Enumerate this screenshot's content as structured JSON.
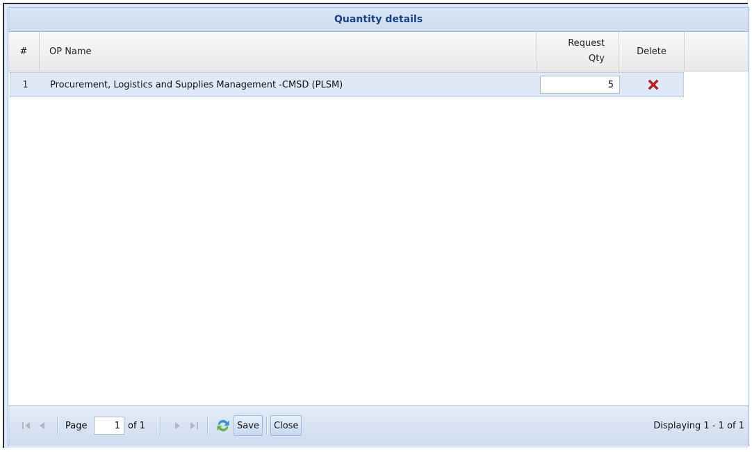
{
  "window": {
    "title": "Quantity details"
  },
  "grid": {
    "columns": {
      "num": "#",
      "op_name": "OP Name",
      "request_qty_line1": "Request",
      "request_qty_line2": "Qty",
      "delete": "Delete"
    },
    "rows": [
      {
        "num": "1",
        "op_name": "Procurement, Logistics and Supplies Management -CMSD (PLSM)",
        "request_qty": "5",
        "delete_icon": "delete-x-icon"
      }
    ]
  },
  "toolbar": {
    "page_label": "Page",
    "page_value": "1",
    "of_label": "of 1",
    "save_label": "Save",
    "close_label": "Close",
    "display_text": "Displaying 1 - 1 of 1",
    "icons": [
      "first-page-icon",
      "prev-page-icon",
      "next-page-icon",
      "last-page-icon",
      "refresh-icon"
    ]
  },
  "colors": {
    "title_text": "#15428b",
    "header_bg": "#dfe8f6",
    "border": "#99bbe8",
    "delete_red": "#c8201a"
  }
}
